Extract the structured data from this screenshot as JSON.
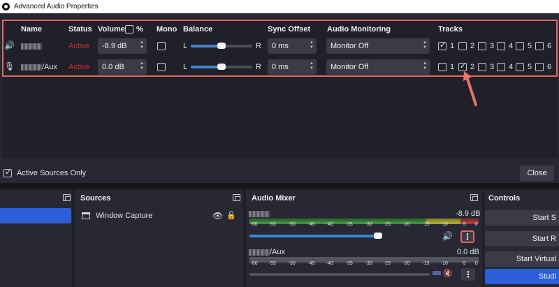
{
  "dialog": {
    "title": "Advanced Audio Properties",
    "headers": {
      "name": "Name",
      "status": "Status",
      "volume": "Volume",
      "percent": "%",
      "mono": "Mono",
      "balance": "Balance",
      "sync_offset": "Sync Offset",
      "audio_monitoring": "Audio Monitoring",
      "tracks": "Tracks"
    },
    "balance_left": "L",
    "balance_right": "R",
    "rows": [
      {
        "icon": "speaker-icon",
        "name_suffix": "",
        "status": "Active",
        "volume": "-8.9 dB",
        "sync": "0 ms",
        "monitoring": "Monitor Off",
        "tracks": [
          "1",
          "2",
          "3",
          "4",
          "5",
          "6"
        ],
        "tracks_checked": [
          true,
          false,
          false,
          false,
          false,
          false
        ]
      },
      {
        "icon": "microphone-icon",
        "name_suffix": "/Aux",
        "status": "Active",
        "volume": "0.0 dB",
        "sync": "0 ms",
        "monitoring": "Monitor Off",
        "tracks": [
          "1",
          "2",
          "3",
          "4",
          "5",
          "6"
        ],
        "tracks_checked": [
          false,
          true,
          false,
          false,
          false,
          false
        ]
      }
    ],
    "active_sources_only": "Active Sources Only",
    "close": "Close"
  },
  "docks": {
    "sources": {
      "title": "Sources",
      "item": "Window Capture"
    },
    "mixer": {
      "title": "Audio Mixer",
      "track1_suffix": "",
      "track1_db": "-8.9 dB",
      "track2_suffix": "/Aux",
      "track2_db": "0.0 dB",
      "ticks": [
        "-60",
        "-55",
        "-50",
        "-45",
        "-40",
        "-35",
        "-30",
        "-25",
        "-20",
        "-15",
        "-10",
        "-5",
        "0"
      ]
    },
    "controls": {
      "title": "Controls",
      "start_streaming": "Start S",
      "start_recording": "Start R",
      "start_virtual": "Start Virtual",
      "studio": "Studi"
    }
  },
  "colors": {
    "accent": "#2b5ed8",
    "status_active": "#d22c2c",
    "highlight": "#e06a60"
  }
}
